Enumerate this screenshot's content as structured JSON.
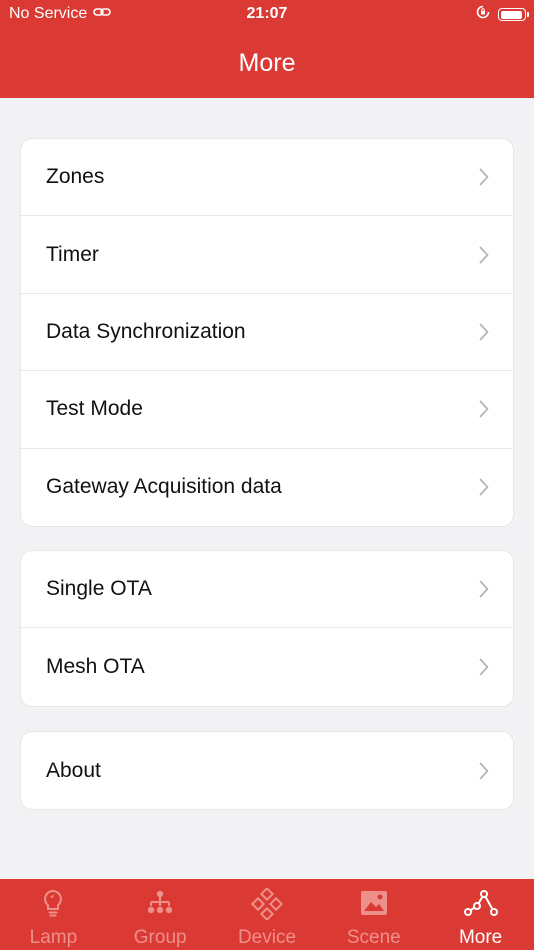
{
  "status_bar": {
    "carrier": "No Service",
    "time": "21:07"
  },
  "nav": {
    "title": "More"
  },
  "groups": [
    {
      "items": [
        {
          "label": "Zones"
        },
        {
          "label": "Timer"
        },
        {
          "label": "Data Synchronization"
        },
        {
          "label": "Test Mode"
        },
        {
          "label": "Gateway Acquisition data"
        }
      ]
    },
    {
      "items": [
        {
          "label": "Single OTA"
        },
        {
          "label": "Mesh OTA"
        }
      ]
    },
    {
      "items": [
        {
          "label": "About"
        }
      ]
    }
  ],
  "tabbar": {
    "tabs": [
      {
        "label": "Lamp",
        "icon": "lightbulb-icon"
      },
      {
        "label": "Group",
        "icon": "group-tree-icon"
      },
      {
        "label": "Device",
        "icon": "device-diamond-icon"
      },
      {
        "label": "Scene",
        "icon": "image-icon"
      },
      {
        "label": "More",
        "icon": "nodes-icon",
        "active": true
      }
    ]
  },
  "colors": {
    "brand": "#db3a34",
    "background": "#f2f2f4",
    "tab_inactive": "#ef8f89",
    "tab_active": "#ffffff"
  }
}
